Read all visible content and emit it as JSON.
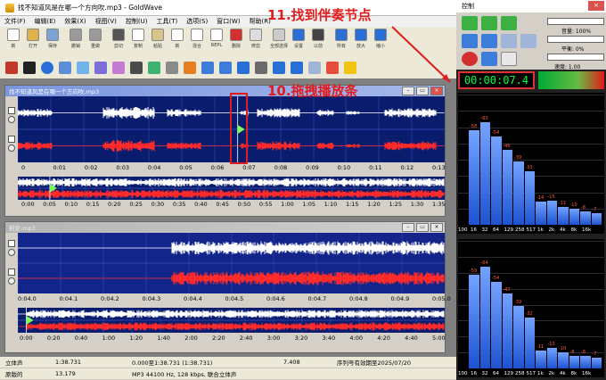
{
  "window": {
    "title": "找不知道风是在哪一个方向吹.mp3 - GoldWave"
  },
  "menu": [
    "文件(F)",
    "编辑(E)",
    "效果(X)",
    "视图(V)",
    "控制(U)",
    "工具(T)",
    "选项(S)",
    "窗口(W)",
    "帮助(R)"
  ],
  "toolbar": [
    {
      "label": "新",
      "icon": "new-file-icon"
    },
    {
      "label": "打开",
      "icon": "open-folder-icon"
    },
    {
      "label": "保存",
      "icon": "save-icon"
    },
    {
      "label": "撤销",
      "icon": "undo-icon"
    },
    {
      "label": "重做",
      "icon": "redo-icon"
    },
    {
      "label": "剪切",
      "icon": "scissors-icon"
    },
    {
      "label": "复制",
      "icon": "copy-icon"
    },
    {
      "label": "粘贴",
      "icon": "paste-icon"
    },
    {
      "label": "新",
      "icon": "paste-new-icon"
    },
    {
      "label": "混合",
      "icon": "mix-icon"
    },
    {
      "label": "REPL",
      "icon": "replace-icon"
    },
    {
      "label": "删除",
      "icon": "delete-icon"
    },
    {
      "label": "修剪",
      "icon": "trim-icon"
    },
    {
      "label": "全部选择",
      "icon": "select-all-icon"
    },
    {
      "label": "设置",
      "icon": "set-icon"
    },
    {
      "label": "以前",
      "icon": "previous-icon"
    },
    {
      "label": "所有",
      "icon": "all-icon"
    },
    {
      "label": "放大",
      "icon": "zoom-in-icon"
    },
    {
      "label": "缩小",
      "icon": "zoom-out-icon"
    }
  ],
  "annotations": {
    "top": "11.找到伴奏节点",
    "middle": "10.拖拽播放条"
  },
  "window1": {
    "title": "找不知道风是在哪一个方向吹.mp3",
    "ticks": [
      "0",
      "0:01",
      "0:02",
      "0:03",
      "0:04",
      "0:05",
      "0:06",
      "0:07",
      "0:08",
      "0:09",
      "0:10",
      "0:11",
      "0:12",
      "0:13"
    ],
    "overview_ticks": [
      "0:00",
      "0:05",
      "0:10",
      "0:15",
      "0:20",
      "0:25",
      "0:30",
      "0:35",
      "0:40",
      "0:45",
      "0:50",
      "0:55",
      "1:00",
      "1:05",
      "1:10",
      "1:15",
      "1:20",
      "1:25",
      "1:30",
      "1:35"
    ]
  },
  "window2": {
    "title": "稻安.mp3",
    "ticks": [
      "0:04.0",
      "0:04.1",
      "0:04.2",
      "0:04.3",
      "0:04.4",
      "0:04.5",
      "0:04.6",
      "0:04.7",
      "0:04.8",
      "0:04.9",
      "0:05.0"
    ],
    "overview_ticks": [
      "0:00",
      "0:20",
      "0:40",
      "1:00",
      "1:20",
      "1:40",
      "2:00",
      "2:20",
      "2:40",
      "3:00",
      "3:20",
      "3:40",
      "4:00",
      "4:20",
      "4:40",
      "5:00"
    ]
  },
  "status": {
    "row1": [
      "立体声",
      "1:38.731",
      "0.000至1:38.731 (1:38.731)",
      "7.408",
      "序列号有效期至2025/07/20"
    ],
    "row2": [
      "原版的",
      "13.179",
      "MP3 44100 Hz, 128 kbps, 联合立体声"
    ]
  },
  "control_panel": {
    "title": "控制",
    "volume": "音量: 100%",
    "balance": "平衡: 0%",
    "speed": "速度: 1.00",
    "time": "00:00:07.4",
    "freq_labels": [
      "100",
      "16",
      "32",
      "64",
      "129",
      "258",
      "517",
      "1k",
      "2k",
      "4k",
      "8k",
      "16k"
    ],
    "spectrum_top": [
      58,
      63,
      54,
      46,
      39,
      33,
      14,
      15,
      11,
      10,
      8,
      7
    ],
    "spectrum_bottom": [
      59,
      64,
      54,
      47,
      39,
      32,
      11,
      13,
      10,
      8,
      8,
      7
    ]
  },
  "colors": {
    "wave_white": "#ffffff",
    "wave_red": "#ff2b2b",
    "wave_bg": "#0a1c6e",
    "annot": "#e21b1b",
    "time_green": "#00ff41"
  }
}
